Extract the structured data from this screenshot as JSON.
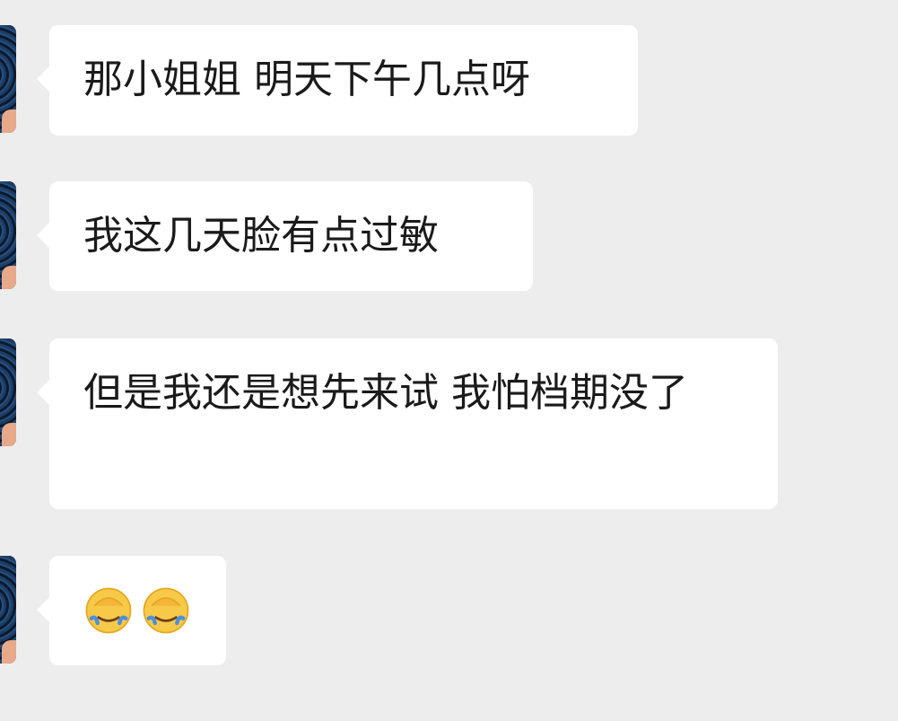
{
  "colors": {
    "background": "#ededed",
    "bubble": "#ffffff",
    "text": "#1a1a1a"
  },
  "messages": [
    {
      "text": "那小姐姐 明天下午几点呀"
    },
    {
      "text": "我这几天脸有点过敏"
    },
    {
      "text": "但是我还是想先来试 我怕档期没了"
    },
    {
      "emojis": [
        "facepalm-icon",
        "facepalm-icon"
      ]
    }
  ]
}
